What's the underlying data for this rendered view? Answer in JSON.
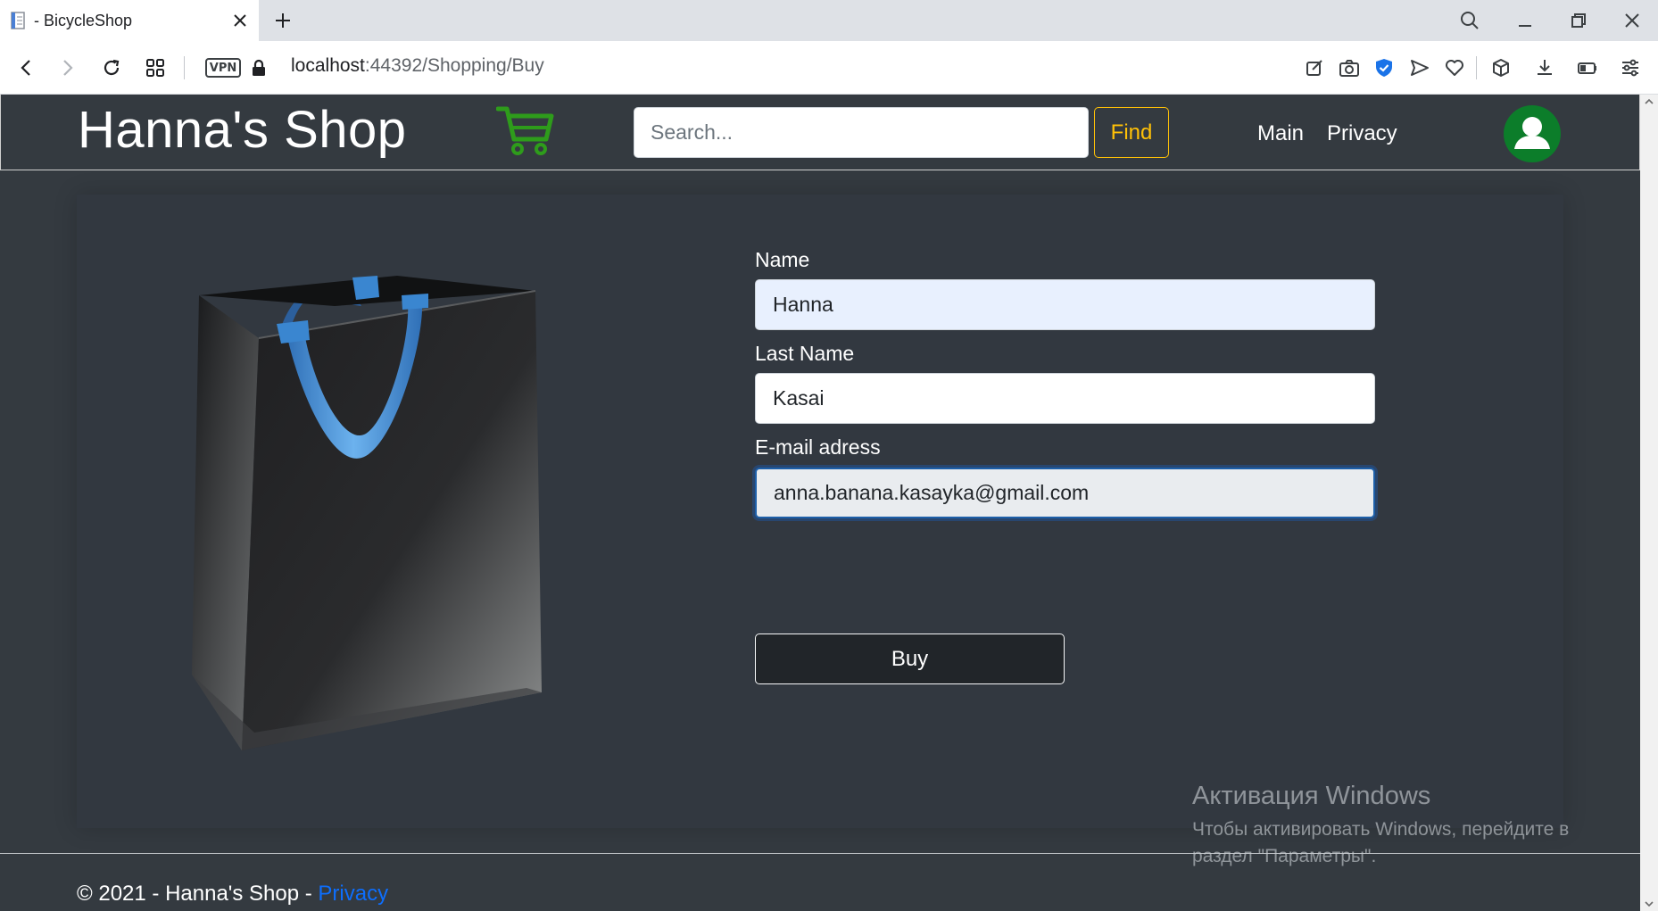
{
  "browser": {
    "tab_title": "- BicycleShop",
    "url_host": "localhost",
    "url_rest": ":44392/Shopping/Buy",
    "vpn_label": "VPN"
  },
  "site": {
    "brand": "Hanna's Shop",
    "search_placeholder": "Search...",
    "find_label": "Find",
    "nav_main": "Main",
    "nav_privacy": "Privacy"
  },
  "form": {
    "name_label": "Name",
    "name_value": "Hanna",
    "lastname_label": "Last Name",
    "lastname_value": "Kasai",
    "email_label": "E-mail adress",
    "email_value": "anna.banana.kasayka@gmail.com",
    "buy_label": "Buy"
  },
  "footer": {
    "text": "© 2021 - Hanna's Shop - ",
    "privacy_link": "Privacy"
  },
  "windows_activation": {
    "title": "Активация Windows",
    "line1": "Чтобы активировать Windows, перейдите в",
    "line2": "раздел \"Параметры\"."
  },
  "colors": {
    "navbar_bg": "#343a40",
    "find_accent": "#ffc107",
    "cart_green": "#2e9c1b",
    "avatar_green": "#0c7d2a",
    "link_blue": "#0d6efd"
  }
}
